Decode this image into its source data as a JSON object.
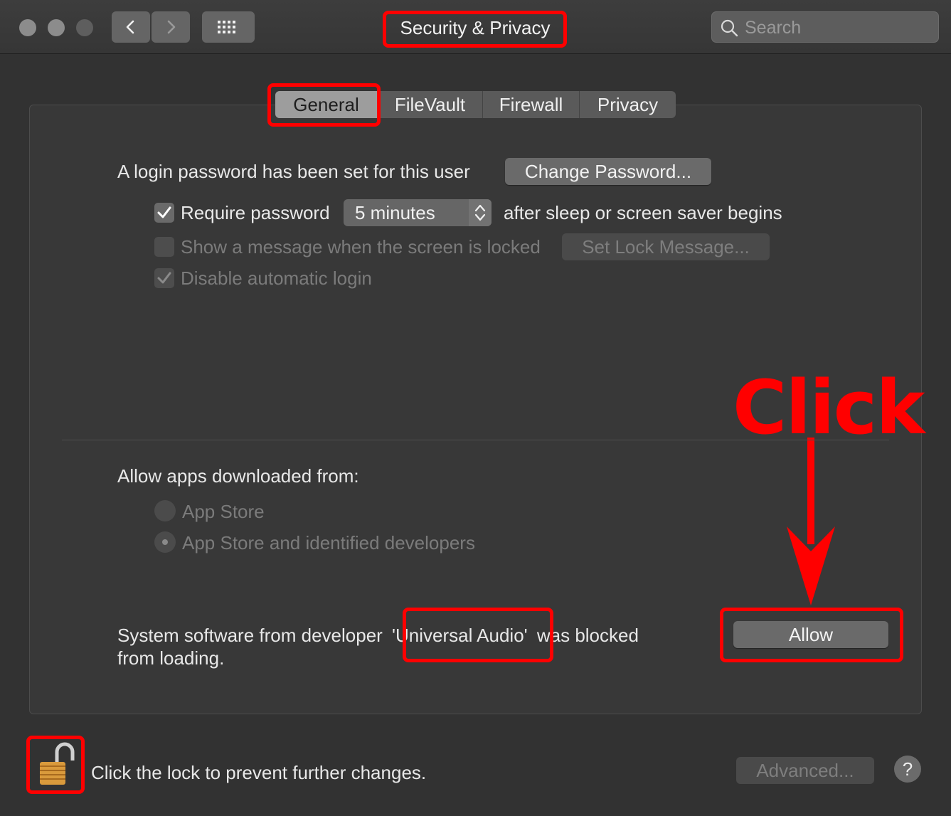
{
  "window": {
    "title": "Security & Privacy",
    "search_placeholder": "Search"
  },
  "tabs": [
    {
      "label": "General",
      "active": true
    },
    {
      "label": "FileVault",
      "active": false
    },
    {
      "label": "Firewall",
      "active": false
    },
    {
      "label": "Privacy",
      "active": false
    }
  ],
  "general": {
    "login_password_text": "A login password has been set for this user",
    "change_password_label": "Change Password...",
    "require_password_label": "Require password",
    "require_password_checked": true,
    "require_password_interval": "5 minutes",
    "after_sleep_text": "after sleep or screen saver begins",
    "show_message_label": "Show a message when the screen is locked",
    "show_message_checked": false,
    "set_lock_message_label": "Set Lock Message...",
    "disable_auto_login_label": "Disable automatic login",
    "disable_auto_login_checked": true
  },
  "gatekeeper": {
    "heading": "Allow apps downloaded from:",
    "options": [
      {
        "label": "App Store",
        "selected": false
      },
      {
        "label": "App Store and identified developers",
        "selected": true
      }
    ]
  },
  "blocked": {
    "text_prefix": "System software from developer ",
    "developer": "'Universal Audio'",
    "text_suffix": " was blocked",
    "text_line2": "from loading.",
    "allow_label": "Allow"
  },
  "annotation": {
    "click_text": "Click",
    "color": "#ff0000"
  },
  "footer": {
    "lock_text": "Click the lock to prevent further changes.",
    "advanced_label": "Advanced...",
    "help_label": "?"
  }
}
